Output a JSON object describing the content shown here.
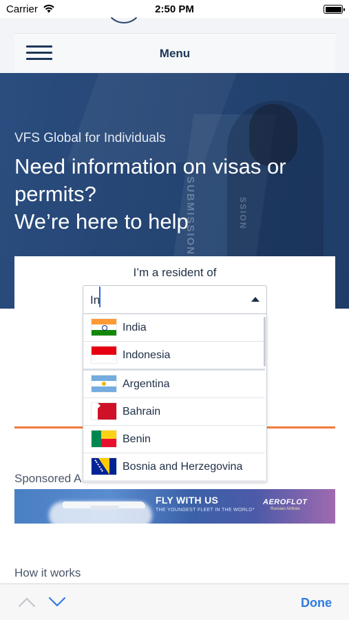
{
  "status_bar": {
    "carrier": "Carrier",
    "time": "2:50 PM"
  },
  "header": {
    "menu_label": "Menu"
  },
  "hero": {
    "kicker": "VFS Global for Individuals",
    "title": "Need information on visas or permits?\nWe’re here to help"
  },
  "resident": {
    "label": "I’m a resident of",
    "select_value": "In",
    "countries": [
      {
        "name": "India",
        "flag": "india-flag-icon"
      },
      {
        "name": "Indonesia",
        "flag": "indonesia-flag-icon"
      },
      {
        "name": "Argentina",
        "flag": "argentina-flag-icon"
      },
      {
        "name": "Bahrain",
        "flag": "bahrain-flag-icon"
      },
      {
        "name": "Benin",
        "flag": "benin-flag-icon"
      },
      {
        "name": "Bosnia and Herzegovina",
        "flag": "bosnia-flag-icon"
      }
    ]
  },
  "sponsored": {
    "label": "Sponsored A",
    "ad_headline": "FLY WITH US",
    "ad_sub": "THE YOUNGEST FLEET IN THE WORLD*",
    "ad_brand": "AEROFLOT",
    "ad_brand_sub": "Russian Airlines"
  },
  "how_it_works": {
    "label": "How it works"
  },
  "accessory": {
    "done_label": "Done"
  },
  "colors": {
    "accent": "#f07a3a",
    "link": "#2f7be0",
    "navy": "#1b3658"
  }
}
